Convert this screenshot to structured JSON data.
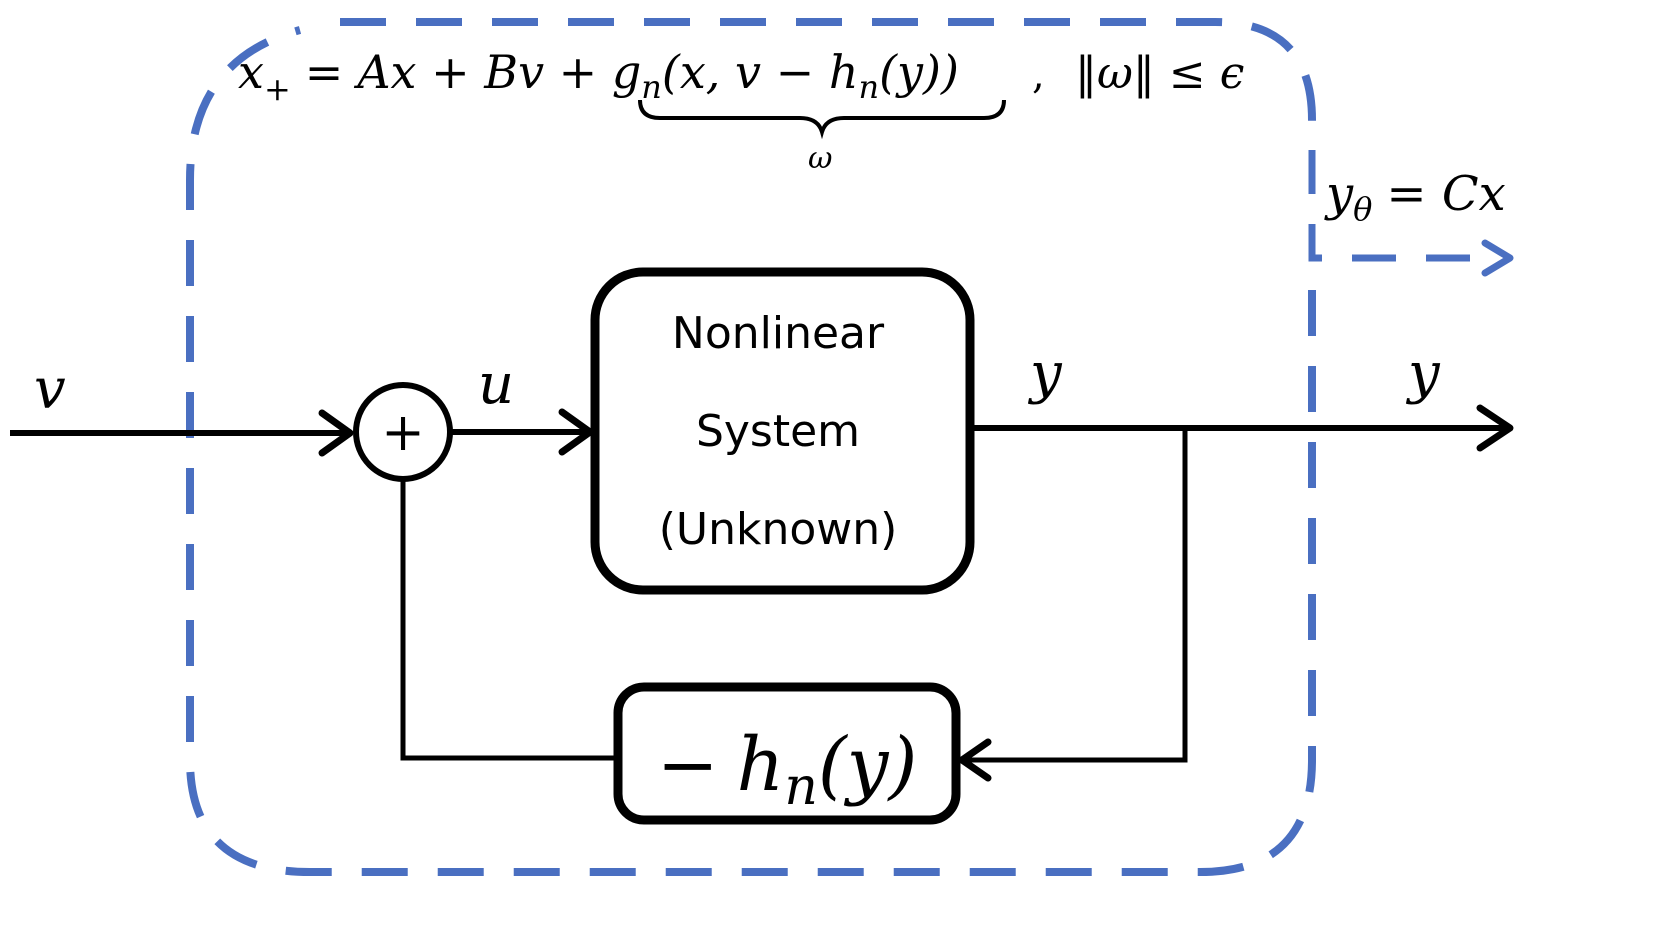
{
  "diagram": {
    "type": "block-diagram",
    "accent_color": "#4a6fc1",
    "line_color": "#000000",
    "equation": {
      "lhs_var": "x",
      "lhs_sub": "+",
      "eq": "=",
      "term1": "Ax + Bv + ",
      "g_func": "g",
      "g_sub": "n",
      "g_args_open": "(x, v − ",
      "h_func": "h",
      "h_sub": "n",
      "h_args": "(y))",
      "underbrace_label": "ω",
      "separator": ",",
      "constraint": "‖ω‖ ≤ ϵ"
    },
    "output_equation": {
      "var": "y",
      "sub": "θ",
      "rhs": "= Cx"
    },
    "signals": {
      "input": "v",
      "control": "u",
      "internal_output": "y",
      "external_output": "y"
    },
    "summing_junction": {
      "symbol": "+"
    },
    "plant_block": {
      "lines": [
        "Nonlinear",
        "System",
        "(Unknown)"
      ]
    },
    "feedback_block": {
      "minus": "−",
      "func": "h",
      "sub": "n",
      "args": "(y)"
    }
  }
}
